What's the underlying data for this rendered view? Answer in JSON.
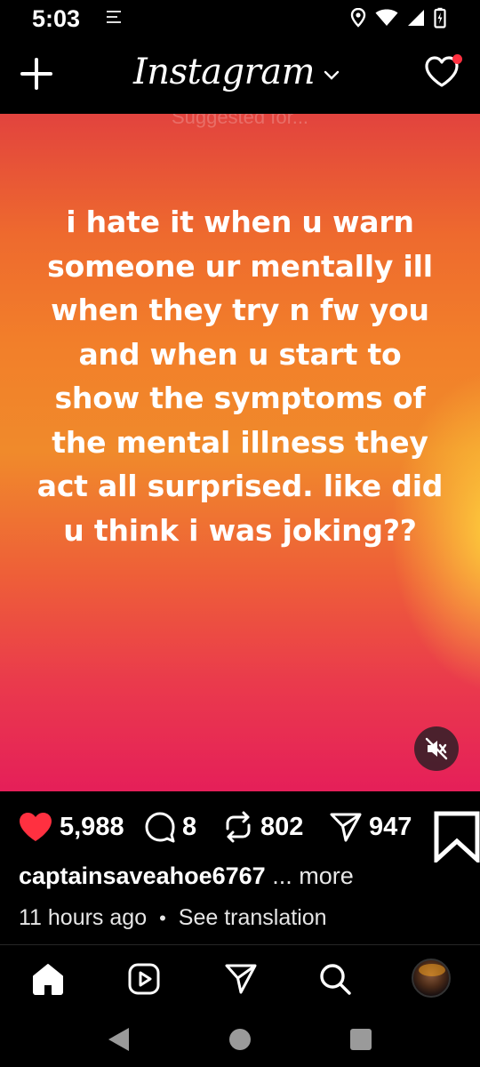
{
  "status_bar": {
    "time": "5:03"
  },
  "header": {
    "logo_text": "Instagram"
  },
  "post": {
    "suggested_label": "Suggested for...",
    "text": "i hate it when u warn someone ur mentally ill when they try n fw you and when u start to show the symptoms of the mental illness they act all surprised. like did u think i was joking??"
  },
  "actions": {
    "likes": "5,988",
    "comments": "8",
    "reposts": "802",
    "shares": "947"
  },
  "caption": {
    "username": "captainsaveahoe6767",
    "more": "... more"
  },
  "meta": {
    "time_ago": "11 hours ago",
    "separator": "•",
    "see_translation": "See translation"
  },
  "colors": {
    "like_red": "#ff3040",
    "background": "#000000",
    "notification_dot": "#ff3040"
  },
  "icons": [
    "plus-icon",
    "chevron-down-icon",
    "heart-icon",
    "mute-icon",
    "comment-icon",
    "repost-icon",
    "share-icon",
    "bookmark-icon",
    "home-icon",
    "reels-icon",
    "send-icon",
    "search-icon",
    "back-icon",
    "home-circle-icon",
    "recents-icon"
  ]
}
